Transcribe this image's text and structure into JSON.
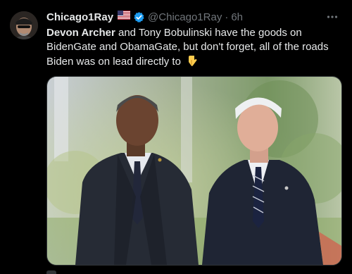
{
  "author": {
    "display_name": "Chicago1Ray",
    "handle": "@Chicago1Ray",
    "separator": "·",
    "timestamp": "6h",
    "flag_icon": "us-flag-icon",
    "verified_icon": "verified-badge-icon"
  },
  "tweet": {
    "text_parts": {
      "bold1": "Devon Archer",
      "mid": " and Tony Bobulinski have the goods on BidenGate and ObamaGate, but don't forget, all of the roads Biden was on lead directly to "
    },
    "emoji": "pointing-down-hand-icon"
  },
  "colors": {
    "background": "#000000",
    "text": "#e7e9ea",
    "secondary": "#71767b",
    "verified": "#1d9bf0",
    "border": "#2f3336"
  }
}
